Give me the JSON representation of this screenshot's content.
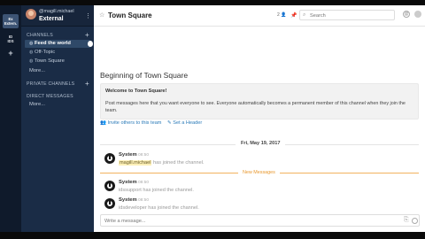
{
  "team_sidebar": {
    "teams": [
      {
        "abbr": "Ex",
        "sub": "Extern."
      },
      {
        "abbr": "ID",
        "sub": "IDS"
      }
    ],
    "add_glyph": "+"
  },
  "sidebar": {
    "username": "@magill.michael",
    "team_name": "External",
    "menu_glyph": "⋮",
    "sections": {
      "channels": {
        "label": "CHANNELS",
        "add": "+"
      },
      "private": {
        "label": "PRIVATE CHANNELS",
        "add": "+"
      },
      "direct": {
        "label": "DIRECT MESSAGES"
      }
    },
    "channels": [
      {
        "label": "Feed the world",
        "icon": "globe-icon",
        "glyph": "◍"
      },
      {
        "label": "Off-Topic",
        "icon": "globe-icon",
        "glyph": "◍"
      },
      {
        "label": "Town Square",
        "icon": "globe-icon",
        "glyph": "◍"
      }
    ],
    "channels_more": "More...",
    "direct_more": "More..."
  },
  "header": {
    "star_glyph": "☆",
    "channel_name": "Town Square",
    "caret": "▾",
    "member_count": "2",
    "member_glyph": "👤",
    "pin_glyph": "📌",
    "search_placeholder": "Search",
    "search_glyph": "⌕",
    "mention_glyph": "@"
  },
  "intro": {
    "title": "Beginning of Town Square",
    "welcome_title": "Welcome to Town Square!",
    "welcome_body": "Post messages here that you want everyone to see. Everyone automatically becomes a permanent member of this channel when they join the team.",
    "invite_label": "Invite others to this team",
    "header_label": "Set a Header"
  },
  "date_separator": "Fri, May 19, 2017",
  "new_messages_label": "New Messages",
  "posts": [
    {
      "author": "System",
      "time": "08:50",
      "highlight": "magill.michael",
      "rest": "has joined the channel."
    },
    {
      "author": "System",
      "time": "08:50",
      "text": "idssupport has joined the channel."
    },
    {
      "author": "System",
      "time": "08:50",
      "text": "idsdeveloper has joined the channel."
    }
  ],
  "composer": {
    "placeholder": "Write a message...",
    "attach_glyph": "⎘"
  },
  "colors": {
    "sidebar_bg": "#1a2c46",
    "team_bar_bg": "#0f1a2b",
    "active_channel": "#2f4968",
    "link": "#2a7ab8",
    "new_messages": "#e8982e"
  }
}
